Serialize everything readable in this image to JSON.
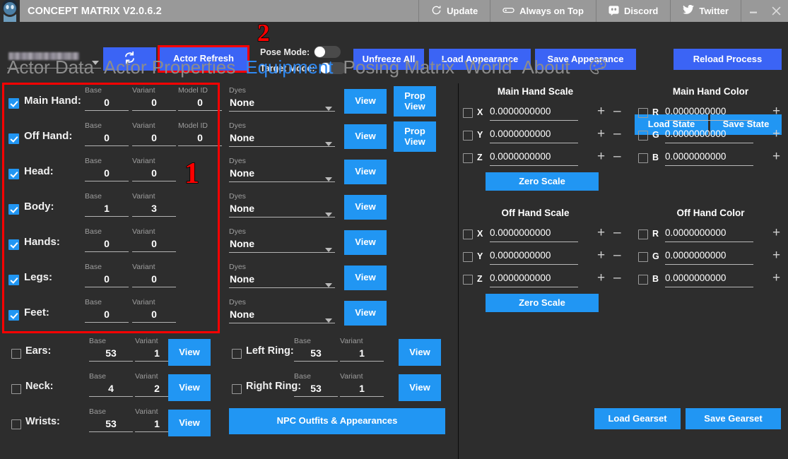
{
  "window": {
    "title": "CONCEPT MATRIX V2.0.6.2",
    "logo_icon": "app-logo-icon",
    "menu": [
      {
        "label": "Update",
        "icon": "update-clock-icon"
      },
      {
        "label": "Always on Top",
        "icon": "pin-capsule-icon"
      },
      {
        "label": "Discord",
        "icon": "discord-icon"
      },
      {
        "label": "Twitter",
        "icon": "twitter-bird-icon"
      }
    ],
    "minimize": "–",
    "close": "✕"
  },
  "toolbar": {
    "actor_select_value": "",
    "refresh_icon": "refresh-sync-icon",
    "actor_refresh_label": "Actor Refresh",
    "pose_mode_label": "Pose Mode:",
    "target_mode_label": "Target Mode:",
    "pose_mode_on": false,
    "target_mode_on": false,
    "unfreeze_all_label": "Unfreeze All",
    "load_appearance_label": "Load Appearance",
    "save_appearance_label": "Save Appearance",
    "reload_process_label": "Reload Process"
  },
  "annotations": {
    "marker_1": "1",
    "marker_2": "2",
    "highlight_color": "#ff0000"
  },
  "tabs": [
    {
      "label": "Actor Data",
      "active": false
    },
    {
      "label": "Actor Properties",
      "active": false
    },
    {
      "label": "Equipment",
      "active": true
    },
    {
      "label": "Posing Matrix",
      "active": false
    },
    {
      "label": "World",
      "active": false
    },
    {
      "label": "About",
      "active": false
    }
  ],
  "tabbar": {
    "palette_icon": "palette-icon",
    "load_state_label": "Load State",
    "save_state_label": "Save State"
  },
  "labels": {
    "base": "Base",
    "variant": "Variant",
    "model_id": "Model ID",
    "dyes": "Dyes",
    "view": "View",
    "prop_view": "Prop\nView",
    "zero_scale": "Zero Scale"
  },
  "equipment": {
    "slots": [
      {
        "name": "Main Hand:",
        "checked": true,
        "base": "0",
        "variant": "0",
        "model_id": "0",
        "dye": "None",
        "view": "View",
        "prop_view": true
      },
      {
        "name": "Off Hand:",
        "checked": true,
        "base": "0",
        "variant": "0",
        "model_id": "0",
        "dye": "None",
        "view": "View",
        "prop_view": true
      },
      {
        "name": "Head:",
        "checked": true,
        "base": "0",
        "variant": "0",
        "model_id": null,
        "dye": "None",
        "view": "View",
        "prop_view": false
      },
      {
        "name": "Body:",
        "checked": true,
        "base": "1",
        "variant": "3",
        "model_id": null,
        "dye": "None",
        "view": "View",
        "prop_view": false
      },
      {
        "name": "Hands:",
        "checked": true,
        "base": "0",
        "variant": "0",
        "model_id": null,
        "dye": "None",
        "view": "View",
        "prop_view": false
      },
      {
        "name": "Legs:",
        "checked": true,
        "base": "0",
        "variant": "0",
        "model_id": null,
        "dye": "None",
        "view": "View",
        "prop_view": false
      },
      {
        "name": "Feet:",
        "checked": true,
        "base": "0",
        "variant": "0",
        "model_id": null,
        "dye": "None",
        "view": "View",
        "prop_view": false
      }
    ],
    "accessories_left": [
      {
        "name": "Ears:",
        "checked": false,
        "base": "53",
        "variant": "1",
        "view": "View"
      },
      {
        "name": "Neck:",
        "checked": false,
        "base": "4",
        "variant": "2",
        "view": "View"
      },
      {
        "name": "Wrists:",
        "checked": false,
        "base": "53",
        "variant": "1",
        "view": "View"
      }
    ],
    "accessories_right": [
      {
        "name": "Left Ring:",
        "checked": false,
        "base": "53",
        "variant": "1",
        "view": "View"
      },
      {
        "name": "Right Ring:",
        "checked": false,
        "base": "53",
        "variant": "1",
        "view": "View"
      }
    ],
    "npc_button_label": "NPC Outfits & Appearances"
  },
  "right_panel": {
    "groups": [
      {
        "title": "Main Hand Scale",
        "kind": "scale",
        "rows": [
          {
            "axis": "X",
            "checked": false,
            "value": "0.0000000000"
          },
          {
            "axis": "Y",
            "checked": false,
            "value": "0.0000000000"
          },
          {
            "axis": "Z",
            "checked": false,
            "value": "0.0000000000"
          }
        ],
        "zero_label": "Zero Scale"
      },
      {
        "title": "Main Hand Color",
        "kind": "color",
        "rows": [
          {
            "axis": "R",
            "checked": false,
            "value": "0.0000000000"
          },
          {
            "axis": "G",
            "checked": false,
            "value": "0.0000000000"
          },
          {
            "axis": "B",
            "checked": false,
            "value": "0.0000000000"
          }
        ],
        "zero_label": null
      },
      {
        "title": "Off Hand Scale",
        "kind": "scale",
        "rows": [
          {
            "axis": "X",
            "checked": false,
            "value": "0.0000000000"
          },
          {
            "axis": "Y",
            "checked": false,
            "value": "0.0000000000"
          },
          {
            "axis": "Z",
            "checked": false,
            "value": "0.0000000000"
          }
        ],
        "zero_label": "Zero Scale"
      },
      {
        "title": "Off Hand Color",
        "kind": "color",
        "rows": [
          {
            "axis": "R",
            "checked": false,
            "value": "0.0000000000"
          },
          {
            "axis": "G",
            "checked": false,
            "value": "0.0000000000"
          },
          {
            "axis": "B",
            "checked": false,
            "value": "0.0000000000"
          }
        ],
        "zero_label": null
      }
    ],
    "plus": "+",
    "minus": "–",
    "load_gearset_label": "Load Gearset",
    "save_gearset_label": "Save Gearset"
  },
  "colors": {
    "window_bg": "#2d2d2d",
    "titlebar_bg": "#999999",
    "accent_blue": "#3b64f5",
    "light_blue": "#2196f3",
    "tab_active": "#2f88f0",
    "tab_inactive": "#8c8c8c",
    "highlight_red": "#ff0000"
  }
}
